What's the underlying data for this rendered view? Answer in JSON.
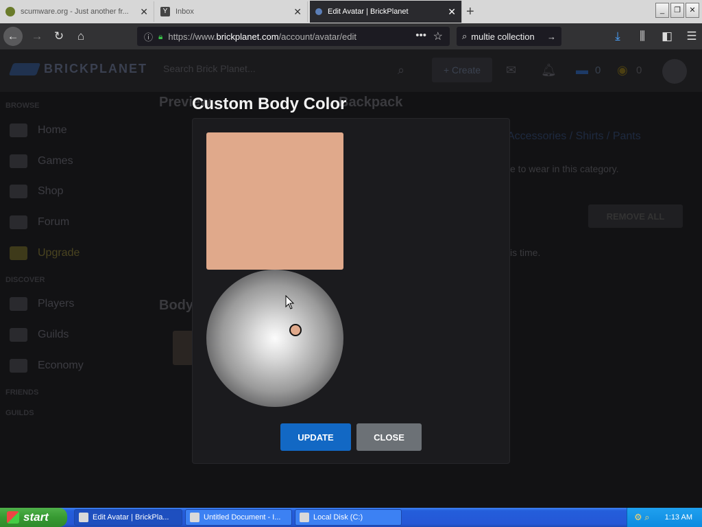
{
  "browser": {
    "tabs": [
      {
        "label": "scumware.org - Just another fr...",
        "active": false
      },
      {
        "label": "Inbox",
        "active": false
      },
      {
        "label": "Edit Avatar | BrickPlanet",
        "active": true
      }
    ],
    "url_prefix": "https://www.",
    "url_domain": "brickplanet.com",
    "url_path": "/account/avatar/edit",
    "search_value": "multie collection"
  },
  "site": {
    "logo_text": "BRICKPLANET",
    "search_placeholder": "Search Brick Planet...",
    "create_label": "+ Create",
    "currency1": "0",
    "currency2": "0",
    "sidebar": {
      "browse_heading": "BROWSE",
      "discover_heading": "DISCOVER",
      "friends_heading": "FRIENDS",
      "guilds_heading": "GUILDS",
      "items": [
        "Home",
        "Games",
        "Shop",
        "Forum",
        "Upgrade",
        "Players",
        "Guilds",
        "Economy"
      ]
    },
    "preview_heading": "Preview",
    "backpack_heading": "Backpack",
    "body_heading": "Body",
    "breadcrumb": "Accessories / Shirts / Pants",
    "wear_text": "e to wear in this category.",
    "remove_all": "REMOVE ALL",
    "time_text": "is time."
  },
  "modal": {
    "title": "Custom Body Color",
    "current_color": "#e0a98b",
    "update_label": "UPDATE",
    "close_label": "CLOSE"
  },
  "taskbar": {
    "start_label": "start",
    "items": [
      "Edit Avatar | BrickPla...",
      "Untitled Document - I...",
      "Local Disk (C:)"
    ],
    "clock": "1:13 AM"
  }
}
